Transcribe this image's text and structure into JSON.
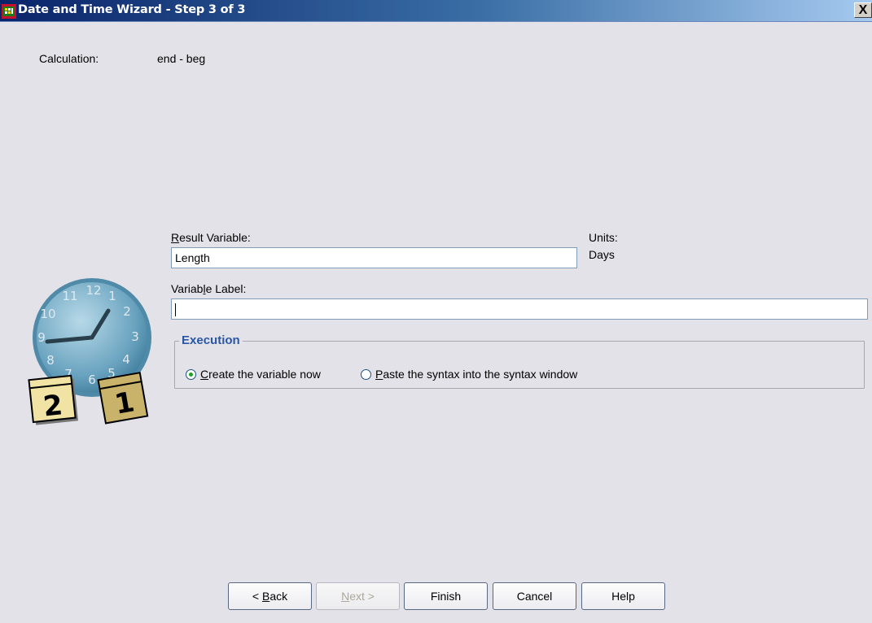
{
  "window": {
    "title": "Date and Time Wizard - Step 3 of 3",
    "close_label": "X"
  },
  "calculation": {
    "label": "Calculation:",
    "value": "end - beg"
  },
  "result_variable": {
    "label_u": "R",
    "label_rest": "esult Variable:",
    "value": "Length"
  },
  "units": {
    "label": "Units:",
    "value": "Days"
  },
  "variable_label": {
    "label_pre": "Variab",
    "label_u": "l",
    "label_post": "e Label:",
    "value": ""
  },
  "execution": {
    "legend": "Execution",
    "option1": {
      "u": "C",
      "rest": "reate the variable now",
      "selected": true
    },
    "option2": {
      "u": "P",
      "rest": "aste the syntax into the syntax window",
      "selected": false
    }
  },
  "buttons": {
    "back_pre": "< ",
    "back_u": "B",
    "back_post": "ack",
    "next_u": "N",
    "next_post": "ext >",
    "finish": "Finish",
    "cancel": "Cancel",
    "help": "Help"
  },
  "clock": {
    "numbers": [
      "12",
      "1",
      "2",
      "3",
      "4",
      "5",
      "6",
      "7",
      "8",
      "9",
      "10",
      "11"
    ],
    "calendar_left": "2",
    "calendar_right": "1"
  }
}
